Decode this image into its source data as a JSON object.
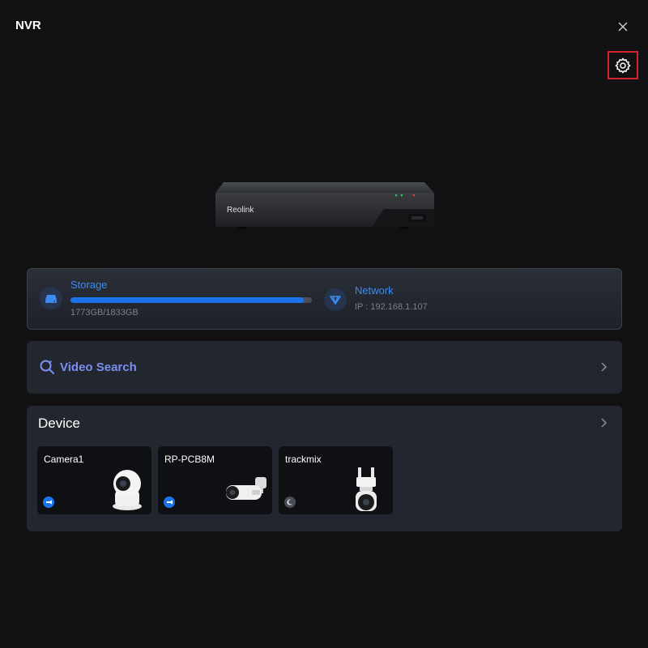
{
  "header": {
    "title": "NVR"
  },
  "icons": {
    "close": "close-icon",
    "settings": "gear-icon",
    "storage": "storage-icon",
    "network": "network-icon",
    "search": "search-icon"
  },
  "nvr": {
    "brand": "Reolink"
  },
  "storage": {
    "label": "Storage",
    "usage_text": "1773GB/1833GB",
    "used_fraction": 0.967
  },
  "network": {
    "label": "Network",
    "ip_text": "IP : 192.168.1.107"
  },
  "video_search": {
    "label": "Video Search"
  },
  "devices": {
    "title": "Device",
    "cameras": [
      {
        "name": "Camera1",
        "status": "online"
      },
      {
        "name": "RP-PCB8M",
        "status": "online"
      },
      {
        "name": "trackmix",
        "status": "sleep"
      }
    ]
  },
  "colors": {
    "accent": "#3d8bf0",
    "progress": "#1a73e8",
    "search_label": "#7b8ff0",
    "highlight_border": "#d3242c"
  }
}
